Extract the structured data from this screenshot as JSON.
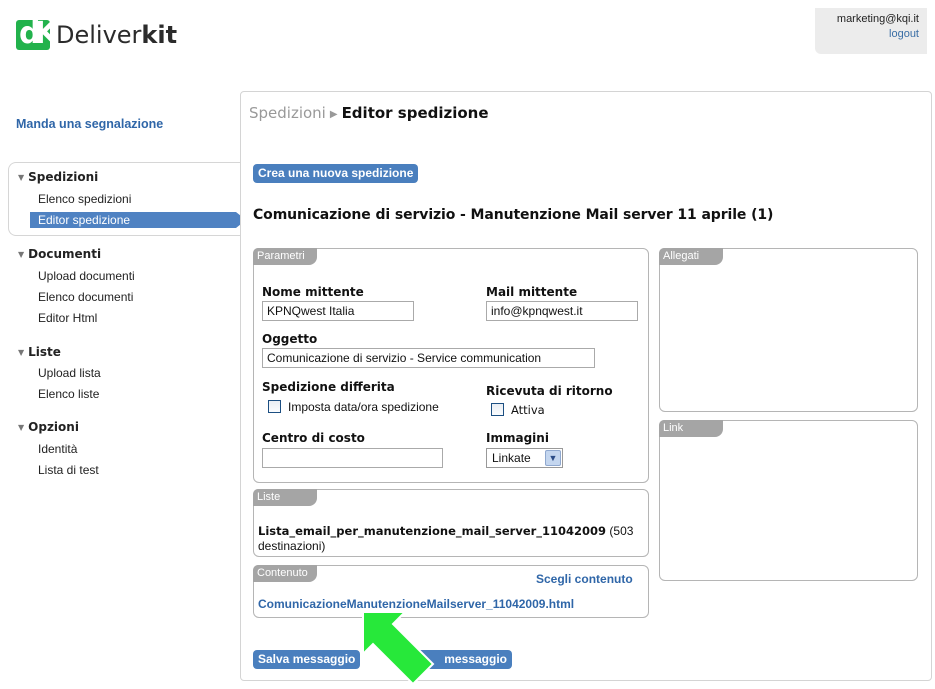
{
  "app": {
    "name_light": "Deliver",
    "name_bold": "kit"
  },
  "user": {
    "email": "marketing@kqi.it",
    "logout_label": "logout"
  },
  "sidebar": {
    "report_link": "Manda una segnalazione",
    "sections": [
      {
        "label": "Spedizioni",
        "items": [
          "Elenco spedizioni",
          "Editor spedizione"
        ]
      },
      {
        "label": "Documenti",
        "items": [
          "Upload documenti",
          "Elenco documenti",
          "Editor Html"
        ]
      },
      {
        "label": "Liste",
        "items": [
          "Upload lista",
          "Elenco liste"
        ]
      },
      {
        "label": "Opzioni",
        "items": [
          "Identità",
          "Lista di test"
        ]
      }
    ],
    "selected_item": "Editor spedizione"
  },
  "breadcrumb": {
    "parent": "Spedizioni",
    "current": "Editor spedizione"
  },
  "main": {
    "new_shipment_button": "Crea una nuova spedizione",
    "shipment_title": "Comunicazione di servizio - Manutenzione Mail server 11 aprile (1)",
    "params": {
      "tab": "Parametri",
      "sender_name_label": "Nome mittente",
      "sender_name_value": "KPNQwest Italia",
      "sender_mail_label": "Mail mittente",
      "sender_mail_value": "info@kpnqwest.it",
      "subject_label": "Oggetto",
      "subject_value": "Comunicazione di servizio - Service communication",
      "deferred_label": "Spedizione differita",
      "deferred_checkbox_label": "Imposta data/ora spedizione",
      "receipt_label": "Ricevuta di ritorno",
      "receipt_checkbox_label": "Attiva",
      "cost_center_label": "Centro di costo",
      "cost_center_value": "",
      "images_label": "Immagini",
      "images_selected": "Linkate"
    },
    "lists": {
      "tab": "Liste",
      "list_name": "Lista_email_per_manutenzione_mail_server_11042009",
      "list_count_line1": "(503",
      "list_count_line2": "destinazioni)"
    },
    "content": {
      "tab": "Contenuto",
      "choose_label": "Scegli contenuto",
      "file_name": "ComunicazioneManutenzioneMailserver_11042009.html"
    },
    "attachments": {
      "tab": "Allegati"
    },
    "links": {
      "tab": "Link"
    },
    "save_button": "Salva messaggio",
    "second_button": "messaggio"
  },
  "colors": {
    "accent": "#4a7fbe",
    "link": "#2f66a8",
    "overlay_arrow": "#27e83a",
    "logo_green": "#22b24c"
  },
  "icons": {
    "overlay": "green-pointer-arrow"
  }
}
